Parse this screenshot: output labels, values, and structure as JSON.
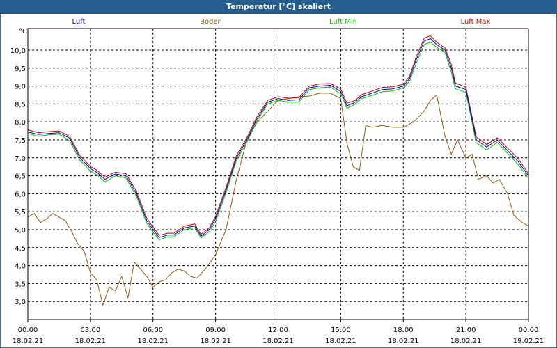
{
  "window": {
    "title": "Temperatur [°C] skaliert"
  },
  "chart_data": {
    "type": "line",
    "title": "Temperatur [°C] skaliert",
    "ylabel": "°C",
    "xlabel": "",
    "ylim": [
      2.5,
      10.6
    ],
    "yticks": [
      "3,0",
      "3,5",
      "4,0",
      "4,5",
      "5,0",
      "5,5",
      "6,0",
      "6,5",
      "7,0",
      "7,5",
      "8,0",
      "8,5",
      "9,0",
      "9,5",
      "10,0"
    ],
    "xlim": [
      0,
      24
    ],
    "xticks": [
      {
        "t": 0,
        "time": "00:00",
        "date": "18.02.21"
      },
      {
        "t": 3,
        "time": "03:00",
        "date": "18.02.21"
      },
      {
        "t": 6,
        "time": "06:00",
        "date": "18.02.21"
      },
      {
        "t": 9,
        "time": "09:00",
        "date": "18.02.21"
      },
      {
        "t": 12,
        "time": "12:00",
        "date": "18.02.21"
      },
      {
        "t": 15,
        "time": "15:00",
        "date": "18.02.21"
      },
      {
        "t": 18,
        "time": "18:00",
        "date": "18.02.21"
      },
      {
        "t": 21,
        "time": "21:00",
        "date": "18.02.21"
      },
      {
        "t": 24,
        "time": "00:00",
        "date": "19.02.21"
      }
    ],
    "grid": true,
    "legend_position": "top",
    "series": [
      {
        "name": "Luft",
        "color": "#0000c0",
        "x": [
          0,
          0.5,
          1,
          1.5,
          2,
          2.5,
          3,
          3.3,
          3.7,
          4.2,
          4.7,
          5.2,
          5.7,
          6,
          6.3,
          6.7,
          7,
          7.5,
          8,
          8.3,
          8.7,
          9,
          9.5,
          10,
          10.5,
          11,
          11.5,
          12,
          12.5,
          13,
          13.5,
          14,
          14.5,
          15,
          15.3,
          15.7,
          16,
          16.5,
          17,
          17.5,
          18,
          18.3,
          18.6,
          19,
          19.3,
          19.6,
          20,
          20.3,
          20.5,
          21,
          21.5,
          22,
          22.5,
          23,
          23.5,
          24
        ],
        "y": [
          7.72,
          7.65,
          7.68,
          7.7,
          7.55,
          7.0,
          6.7,
          6.6,
          6.4,
          6.55,
          6.5,
          6.0,
          5.25,
          5.0,
          4.78,
          4.85,
          4.85,
          5.05,
          5.1,
          4.82,
          5.0,
          5.3,
          6.1,
          7.0,
          7.5,
          8.1,
          8.55,
          8.65,
          8.6,
          8.62,
          8.95,
          9.0,
          9.02,
          8.85,
          8.45,
          8.55,
          8.7,
          8.8,
          8.9,
          8.92,
          9.0,
          9.2,
          9.7,
          10.25,
          10.32,
          10.15,
          10.0,
          9.5,
          9.0,
          8.9,
          7.5,
          7.3,
          7.5,
          7.2,
          6.9,
          6.5
        ]
      },
      {
        "name": "Boden",
        "color": "#8b5a14",
        "x": [
          0,
          0.3,
          0.6,
          0.9,
          1.2,
          1.5,
          1.8,
          2.1,
          2.4,
          2.7,
          3,
          3.3,
          3.6,
          3.9,
          4.2,
          4.5,
          4.8,
          5.1,
          5.4,
          5.7,
          6,
          6.3,
          6.6,
          6.9,
          7.2,
          7.5,
          7.8,
          8.1,
          8.5,
          9,
          9.5,
          10,
          10.5,
          11,
          11.5,
          12,
          12.5,
          13,
          13.5,
          14,
          14.5,
          15,
          15.3,
          15.6,
          15.9,
          16.2,
          16.5,
          17,
          17.5,
          18,
          18.5,
          19,
          19.3,
          19.6,
          20,
          20.3,
          20.6,
          21,
          21.3,
          21.6,
          22,
          22.3,
          22.6,
          23,
          23.3,
          23.7,
          24
        ],
        "y": [
          5.35,
          5.45,
          5.2,
          5.3,
          5.45,
          5.35,
          5.25,
          4.95,
          4.6,
          4.4,
          3.8,
          3.6,
          2.9,
          3.4,
          3.3,
          3.7,
          3.1,
          4.1,
          3.9,
          3.7,
          3.4,
          3.55,
          3.6,
          3.8,
          3.9,
          3.85,
          3.7,
          3.65,
          3.9,
          4.3,
          5.0,
          6.4,
          7.5,
          8.0,
          8.3,
          8.6,
          8.65,
          8.7,
          8.72,
          8.8,
          8.8,
          8.65,
          7.4,
          6.75,
          6.65,
          7.9,
          7.85,
          7.9,
          7.85,
          7.85,
          8.0,
          8.3,
          8.6,
          8.75,
          7.6,
          7.1,
          7.5,
          7.0,
          7.1,
          6.4,
          6.5,
          6.3,
          6.4,
          6.0,
          5.4,
          5.2,
          5.1
        ]
      },
      {
        "name": "Luft Min",
        "color": "#00c000",
        "x": [
          0,
          0.5,
          1,
          1.5,
          2,
          2.5,
          3,
          3.3,
          3.7,
          4.2,
          4.7,
          5.2,
          5.7,
          6,
          6.3,
          6.7,
          7,
          7.5,
          8,
          8.3,
          8.7,
          9,
          9.5,
          10,
          10.5,
          11,
          11.5,
          12,
          12.5,
          13,
          13.5,
          14,
          14.5,
          15,
          15.3,
          15.7,
          16,
          16.5,
          17,
          17.5,
          18,
          18.3,
          18.6,
          19,
          19.3,
          19.6,
          20,
          20.3,
          20.5,
          21,
          21.5,
          22,
          22.5,
          23,
          23.5,
          24
        ],
        "y": [
          7.68,
          7.6,
          7.64,
          7.66,
          7.48,
          6.93,
          6.63,
          6.53,
          6.33,
          6.5,
          6.44,
          5.93,
          5.18,
          4.93,
          4.72,
          4.8,
          4.8,
          5.0,
          5.05,
          4.77,
          4.95,
          5.22,
          6.03,
          6.93,
          7.44,
          8.04,
          8.5,
          8.6,
          8.55,
          8.56,
          8.9,
          8.95,
          8.97,
          8.78,
          8.38,
          8.5,
          8.65,
          8.74,
          8.84,
          8.86,
          8.95,
          9.13,
          9.6,
          10.15,
          10.22,
          10.08,
          9.93,
          9.38,
          8.92,
          8.82,
          7.42,
          7.22,
          7.43,
          7.13,
          6.82,
          6.43
        ]
      },
      {
        "name": "Luft Max",
        "color": "#c00000",
        "x": [
          0,
          0.5,
          1,
          1.5,
          2,
          2.5,
          3,
          3.3,
          3.7,
          4.2,
          4.7,
          5.2,
          5.7,
          6,
          6.3,
          6.7,
          7,
          7.5,
          8,
          8.3,
          8.7,
          9,
          9.5,
          10,
          10.5,
          11,
          11.5,
          12,
          12.5,
          13,
          13.5,
          14,
          14.5,
          15,
          15.3,
          15.7,
          16,
          16.5,
          17,
          17.5,
          18,
          18.3,
          18.6,
          19,
          19.3,
          19.6,
          20,
          20.3,
          20.5,
          21,
          21.5,
          22,
          22.5,
          23,
          23.5,
          24
        ],
        "y": [
          7.78,
          7.7,
          7.73,
          7.75,
          7.6,
          7.06,
          6.76,
          6.66,
          6.46,
          6.6,
          6.56,
          6.07,
          5.32,
          5.07,
          4.84,
          4.9,
          4.9,
          5.1,
          5.16,
          4.87,
          5.05,
          5.37,
          6.17,
          7.07,
          7.56,
          8.16,
          8.6,
          8.7,
          8.66,
          8.68,
          9.0,
          9.06,
          9.07,
          8.92,
          8.52,
          8.6,
          8.76,
          8.86,
          8.96,
          8.98,
          9.05,
          9.27,
          9.78,
          10.33,
          10.4,
          10.22,
          10.06,
          9.6,
          9.08,
          8.97,
          7.58,
          7.37,
          7.56,
          7.27,
          6.98,
          6.56
        ]
      }
    ]
  }
}
